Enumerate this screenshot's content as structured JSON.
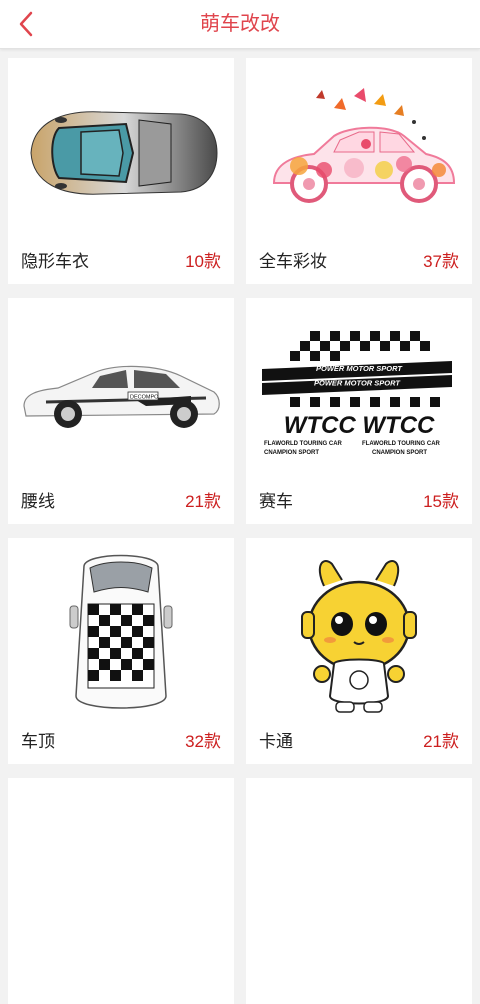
{
  "header": {
    "title": "萌车改改"
  },
  "colors": {
    "accent": "#e0454d",
    "count": "#cc1f1f"
  },
  "categories": [
    {
      "name": "隐形车衣",
      "count": "10款",
      "icon": "car-top-view-image"
    },
    {
      "name": "全车彩妆",
      "count": "37款",
      "icon": "floral-car-image"
    },
    {
      "name": "腰线",
      "count": "21款",
      "icon": "white-sedan-decal-image"
    },
    {
      "name": "赛车",
      "count": "15款",
      "icon": "racing-flag-decal-image"
    },
    {
      "name": "车顶",
      "count": "32款",
      "icon": "checkered-roof-image"
    },
    {
      "name": "卡通",
      "count": "21款",
      "icon": "cartoon-mascot-image"
    }
  ],
  "decal_text": {
    "power_motor_sport_1": "POWER MOTOR SPORT",
    "power_motor_sport_2": "POWER MOTOR SPORT",
    "wtcc": "WTCC WTCC",
    "flaworld_left": "FLAWORLD TOURING CAR",
    "flaworld_right": "FLAWORLD TOURING CAR",
    "champion_left": "CNAMPION SPORT",
    "champion_right": "CNAMPION SPORT",
    "door_badge": "DECOMPO"
  }
}
